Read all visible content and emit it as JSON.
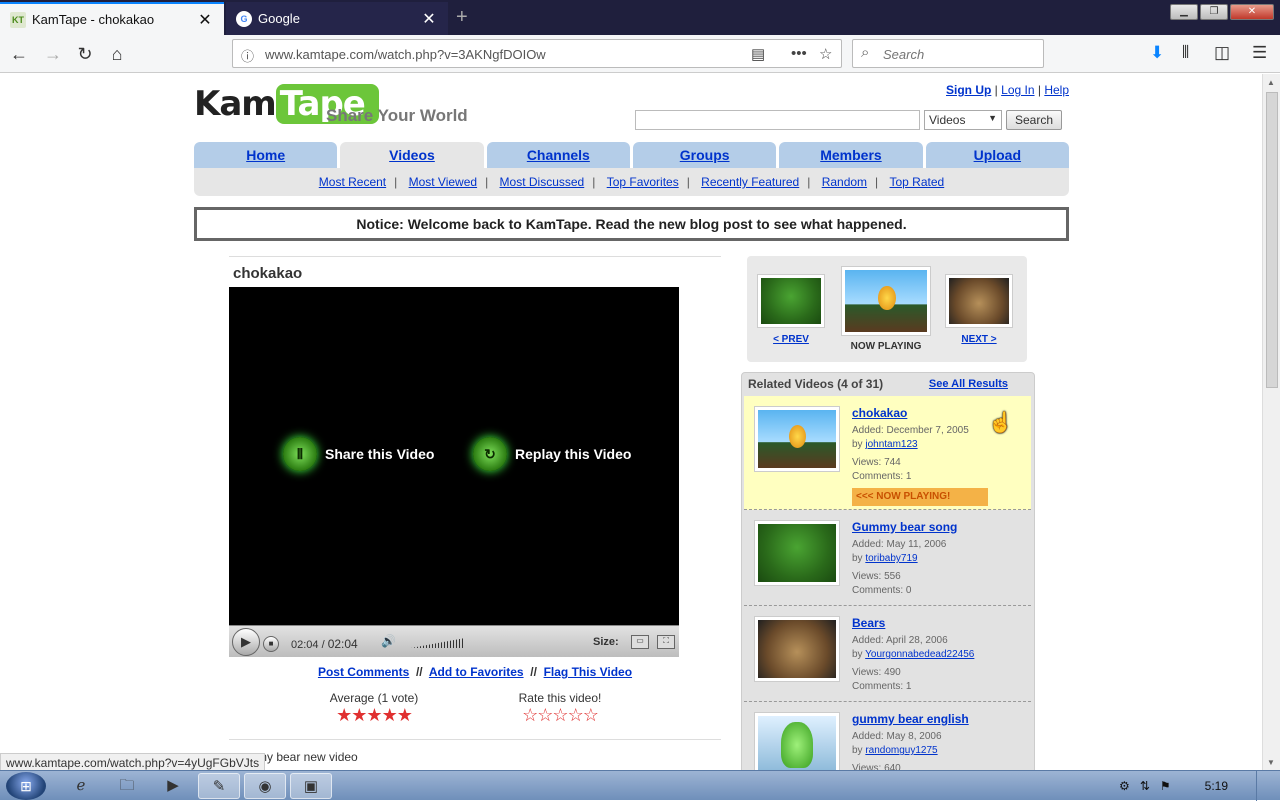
{
  "browser": {
    "tabs": [
      {
        "title": "KamTape - chokakao",
        "active": true,
        "favicon": "kamtape-icon"
      },
      {
        "title": "Google",
        "active": false,
        "favicon": "google-icon"
      }
    ],
    "url": "www.kamtape.com/watch.php?v=3AKNgfDOIOw",
    "search_placeholder": "Search",
    "status_url": "www.kamtape.com/watch.php?v=4yUgFGbVJts"
  },
  "header": {
    "logo_part1": "Kam",
    "logo_part2": "Tape",
    "tagline": "Share Your World",
    "sign_up": "Sign Up",
    "log_in": "Log In",
    "help": "Help",
    "search_select": "Videos",
    "search_button": "Search"
  },
  "nav": {
    "tabs": [
      "Home",
      "Videos",
      "Channels",
      "Groups",
      "Members",
      "Upload"
    ],
    "selected": "Videos",
    "subnav": [
      "Most Recent",
      "Most Viewed",
      "Most Discussed",
      "Top Favorites",
      "Recently Featured",
      "Random",
      "Top Rated"
    ]
  },
  "notice": "Notice: Welcome back to KamTape. Read the new blog post to see what happened.",
  "video": {
    "title": "chokakao",
    "share_label": "Share this Video",
    "replay_label": "Replay this Video",
    "time_current": "02:04",
    "time_total": "02:04",
    "size_label": "Size:",
    "post_comments": "Post Comments",
    "add_favorites": "Add to Favorites",
    "flag": "Flag This Video",
    "sep": "//",
    "average_label": "Average (1 vote)",
    "average_stars": 5,
    "rate_label": "Rate this video!",
    "description": "my bear new video"
  },
  "carousel": {
    "prev_label": "< PREV",
    "now_label": "NOW PLAYING",
    "next_label": "NEXT >"
  },
  "related": {
    "header": "Related Videos (4 of 31)",
    "see_all": "See All Results",
    "added_prefix": "Added:",
    "by_prefix": "by",
    "views_prefix": "Views:",
    "comments_prefix": "Comments:",
    "now_playing_tag": "<<< NOW PLAYING!",
    "items": [
      {
        "title": "chokakao",
        "added": "December 7, 2005",
        "by": "johntam123",
        "views": "744",
        "comments": "1",
        "now": true
      },
      {
        "title": "Gummy bear song",
        "added": "May 11, 2006",
        "by": "toribaby719",
        "views": "556",
        "comments": "0",
        "now": false
      },
      {
        "title": "Bears",
        "added": "April 28, 2006",
        "by": "Yourgonnabedead22456",
        "views": "490",
        "comments": "1",
        "now": false
      },
      {
        "title": "gummy bear english",
        "added": "May 8, 2006",
        "by": "randomguy1275",
        "views": "640",
        "comments": "",
        "now": false
      }
    ]
  },
  "taskbar": {
    "clock": "5:19"
  }
}
